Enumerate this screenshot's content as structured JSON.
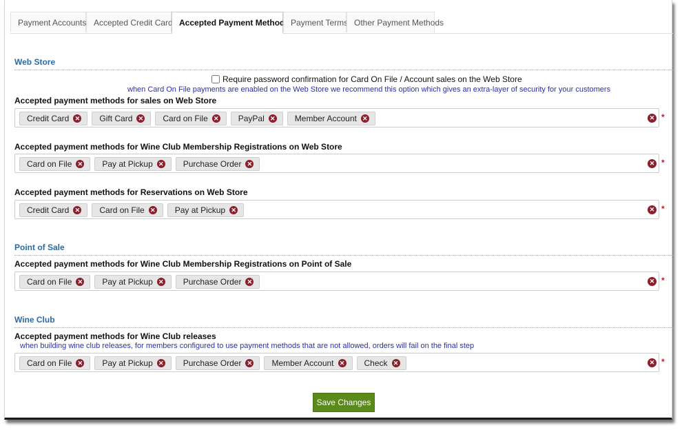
{
  "tabs": [
    {
      "label": "Payment Accounts"
    },
    {
      "label": "Accepted Credit Cards"
    },
    {
      "label": "Accepted Payment Methods"
    },
    {
      "label": "Payment Terms"
    },
    {
      "label": "Other Payment Methods"
    }
  ],
  "web_store": {
    "heading": "Web Store",
    "confirm_label": "Require password confirmation for Card On File / Account sales on the Web Store",
    "confirm_hint": "when Card On File payments are enabled on the Web Store we recommend this option which gives an extra-layer of security for your customers",
    "sales_label": "Accepted payment methods for sales on Web Store",
    "sales_methods": [
      "Credit Card",
      "Gift Card",
      "Card on File",
      "PayPal",
      "Member Account"
    ],
    "club_label": "Accepted payment methods for Wine Club Membership Registrations on Web Store",
    "club_methods": [
      "Card on File",
      "Pay at Pickup",
      "Purchase Order"
    ],
    "res_label": "Accepted payment methods for Reservations on Web Store",
    "res_methods": [
      "Credit Card",
      "Card on File",
      "Pay at Pickup"
    ]
  },
  "pos": {
    "heading": "Point of Sale",
    "club_label": "Accepted payment methods for Wine Club Membership Registrations on Point of Sale",
    "club_methods": [
      "Card on File",
      "Pay at Pickup",
      "Purchase Order"
    ]
  },
  "wine_club": {
    "heading": "Wine Club",
    "releases_label": "Accepted payment methods for Wine Club releases",
    "releases_hint": "when building wine club releases, for members configured to use payment methods that are not allowed, orders will fail on the final step",
    "releases_methods": [
      "Card on File",
      "Pay at Pickup",
      "Purchase Order",
      "Member Account",
      "Check"
    ]
  },
  "required_mark": "*",
  "remove_glyph": "✕",
  "save_label": "Save Changes",
  "colors": {
    "accent": "#2a6aa6",
    "hint": "#2b2fa6",
    "remove": "#8b1f2b",
    "save": "#5a8a1a",
    "required": "#c0182b"
  }
}
